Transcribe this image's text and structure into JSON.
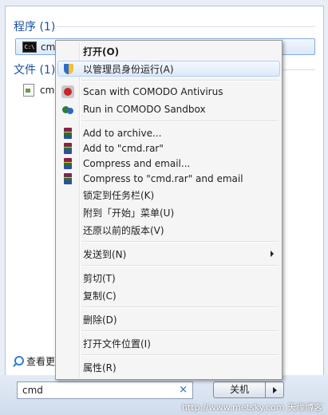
{
  "start_menu": {
    "programs_header": "程序 (1)",
    "program_result": "cmd",
    "files_header": "文件 (1)",
    "file_result": "cmd",
    "see_more": "查看更",
    "search_value": "cmd",
    "clear_glyph": "×",
    "shutdown_label": "关机"
  },
  "context_menu": {
    "open": "打开(O)",
    "run_as_admin": "以管理员身份运行(A)",
    "scan_comodo": "Scan with COMODO Antivirus",
    "run_sandbox": "Run in COMODO Sandbox",
    "add_archive": "Add to archive...",
    "add_cmd_rar": "Add to \"cmd.rar\"",
    "compress_email": "Compress and email...",
    "compress_cmd_email": "Compress to \"cmd.rar\" and email",
    "pin_taskbar": "锁定到任务栏(K)",
    "pin_start": "附到「开始」菜单(U)",
    "restore_versions": "还原以前的版本(V)",
    "send_to": "发送到(N)",
    "cut": "剪切(T)",
    "copy": "复制(C)",
    "delete": "删除(D)",
    "open_location": "打开文件位置(I)",
    "properties": "属性(R)"
  },
  "watermark": "http://www.metsky.com  天缘博客",
  "icons": {
    "program": "cmd-console-icon",
    "file": "file-icon",
    "see_more": "magnifier-icon",
    "run_as_admin": "uac-shield-icon",
    "scan": "comodo-scan-icon",
    "sandbox": "comodo-sandbox-icon",
    "archive": "winrar-icon"
  },
  "colors": {
    "section_header": "#1a4fa3",
    "highlight_border": "#aecff7",
    "selection_border": "#84acdd"
  }
}
